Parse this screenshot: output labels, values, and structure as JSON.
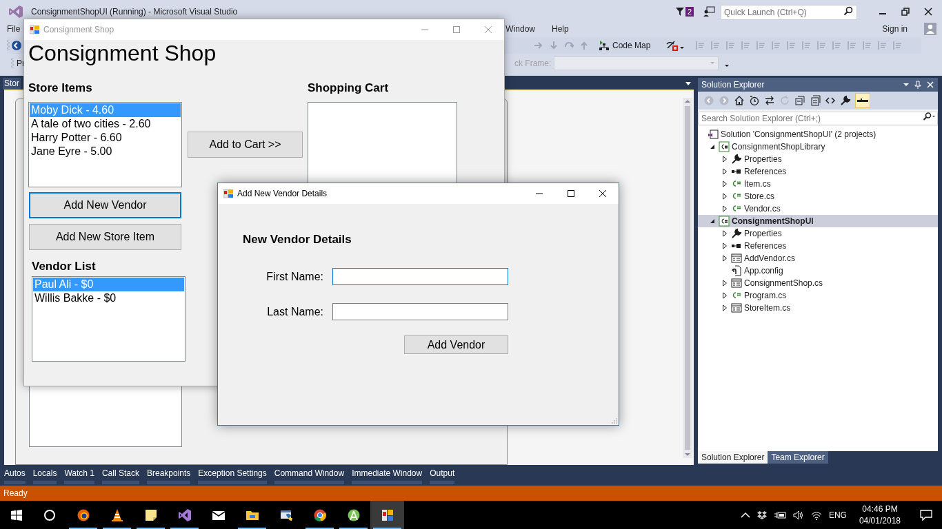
{
  "vs_window": {
    "title": "ConsignmentShopUI (Running) - Microsoft Visual Studio",
    "notification_count": "2",
    "quick_launch": {
      "placeholder": "Quick Launch (Ctrl+Q)"
    },
    "menu": [
      {
        "label": "File"
      },
      {
        "label": "Window"
      },
      {
        "label": "Help"
      }
    ],
    "sign_in": "Sign in",
    "toolbar": {
      "cut_label": "Pr",
      "code_map": "Code Map",
      "stack_frame_label": "ck Frame:"
    },
    "document_tab": {
      "label": "Stor",
      "selected": true
    },
    "solution_explorer": {
      "title": "Solution Explorer",
      "search": {
        "placeholder": "Search Solution Explorer (Ctrl+;)"
      },
      "tree": [
        {
          "kind": "solution",
          "label": "Solution 'ConsignmentShopUI' (2 projects)",
          "selected": false,
          "children": [
            {
              "kind": "project",
              "label": "ConsignmentShopLibrary",
              "expanded": true,
              "startup": false,
              "selected": false,
              "children": [
                {
                  "kind": "properties",
                  "label": "Properties",
                  "expanded": false,
                  "selected": false
                },
                {
                  "kind": "references",
                  "label": "References",
                  "expanded": false,
                  "selected": false
                },
                {
                  "kind": "code",
                  "label": "Item.cs",
                  "expanded": false,
                  "selected": false
                },
                {
                  "kind": "code",
                  "label": "Store.cs",
                  "expanded": false,
                  "selected": false
                },
                {
                  "kind": "code",
                  "label": "Vendor.cs",
                  "expanded": false,
                  "selected": false
                }
              ]
            },
            {
              "kind": "project",
              "label": "ConsignmentShopUI",
              "expanded": true,
              "startup": true,
              "selected": true,
              "children": [
                {
                  "kind": "properties",
                  "label": "Properties",
                  "expanded": false,
                  "selected": false
                },
                {
                  "kind": "references",
                  "label": "References",
                  "expanded": false,
                  "selected": false
                },
                {
                  "kind": "form",
                  "label": "AddVendor.cs",
                  "expanded": false,
                  "selected": false
                },
                {
                  "kind": "config",
                  "label": "App.config",
                  "selected": false
                },
                {
                  "kind": "form",
                  "label": "ConsignmentShop.cs",
                  "expanded": false,
                  "selected": false
                },
                {
                  "kind": "code",
                  "label": "Program.cs",
                  "expanded": false,
                  "selected": false
                },
                {
                  "kind": "form",
                  "label": "StoreItem.cs",
                  "expanded": false,
                  "selected": false
                }
              ]
            }
          ]
        }
      ],
      "tabs": [
        {
          "label": "Solution Explorer",
          "selected": true
        },
        {
          "label": "Team Explorer",
          "selected": false
        }
      ]
    },
    "tool_tabs": [
      "Autos",
      "Locals",
      "Watch 1",
      "Call Stack",
      "Breakpoints",
      "Exception Settings",
      "Command Window",
      "Immediate Window",
      "Output"
    ],
    "status": "Ready"
  },
  "consignment_shop": {
    "title": "Consignment Shop",
    "heading": "Consignment Shop",
    "store_items": {
      "label": "Store Items",
      "items": [
        {
          "text": "Moby Dick - 4.60",
          "selected": true
        },
        {
          "text": "A tale of two cities - 2.60",
          "selected": false
        },
        {
          "text": "Harry Potter - 6.60",
          "selected": false
        },
        {
          "text": "Jane Eyre - 5.00",
          "selected": false
        }
      ]
    },
    "add_to_cart": {
      "label": "Add to Cart >>",
      "focused": false
    },
    "shopping_cart": {
      "label": "Shopping Cart"
    },
    "add_vendor": {
      "label": "Add New Vendor",
      "focused": true
    },
    "add_store_item": {
      "label": "Add New Store Item",
      "focused": false
    },
    "vendor_list": {
      "label": "Vendor List",
      "items": [
        {
          "text": "Paul Ali - $0",
          "selected": true
        },
        {
          "text": "Willis Bakke - $0",
          "selected": false
        }
      ]
    }
  },
  "add_vendor_dialog": {
    "title": "Add New Vendor Details",
    "heading": "New Vendor Details",
    "fields": [
      {
        "label": "First Name:"
      },
      {
        "label": "Last Name:"
      }
    ],
    "button": "Add Vendor"
  },
  "taskbar": {
    "apps": [
      {
        "kind": "start"
      },
      {
        "kind": "search"
      },
      {
        "kind": "firefox",
        "running": true
      },
      {
        "kind": "vlc",
        "running": true
      },
      {
        "kind": "notes",
        "running": true
      },
      {
        "kind": "vs",
        "running": true,
        "selected": false
      },
      {
        "kind": "mail",
        "running": false
      },
      {
        "kind": "explorer",
        "running": true
      },
      {
        "kind": "python",
        "running": false
      },
      {
        "kind": "chrome",
        "running": true
      },
      {
        "kind": "android",
        "running": true
      },
      {
        "kind": "winforms",
        "running": true,
        "selected": true
      }
    ],
    "language": "ENG",
    "time": "04:46 PM",
    "date": "04/01/2018"
  }
}
